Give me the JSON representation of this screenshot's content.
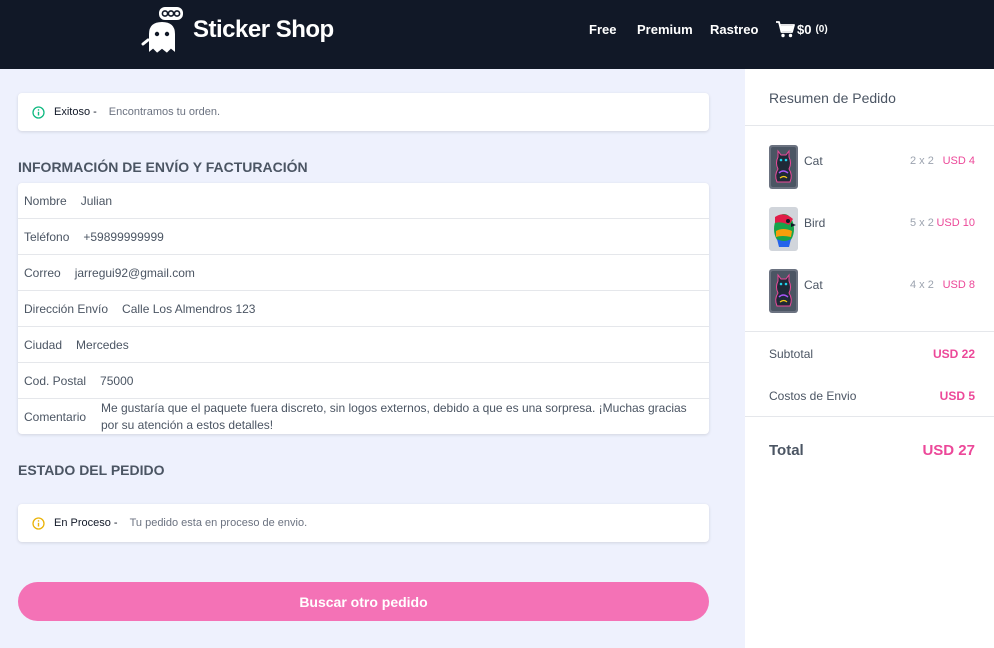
{
  "header": {
    "brand": "Sticker Shop",
    "logo_icon": "ghost-boo-icon",
    "nav": [
      "Free",
      "Premium",
      "Rastreo"
    ],
    "cart_icon": "cart-icon",
    "cart_total": "$0",
    "cart_count": "(0)"
  },
  "success_alert": {
    "icon": "info-circle-icon",
    "color": "#10b981",
    "label": "Exitoso -",
    "message": "Encontramos tu orden."
  },
  "shipping": {
    "title": "INFORMACIÓN DE ENVÍO Y FACTURACIÓN",
    "fields": [
      {
        "label": "Nombre",
        "value": "Julian"
      },
      {
        "label": "Teléfono",
        "value": "+59899999999"
      },
      {
        "label": "Correo",
        "value": "jarregui92@gmail.com"
      },
      {
        "label": "Dirección Envío",
        "value": "Calle Los Almendros 123"
      },
      {
        "label": "Ciudad",
        "value": "Mercedes"
      },
      {
        "label": "Cod. Postal",
        "value": "75000"
      },
      {
        "label": "Comentario",
        "value": "Me gustaría que el paquete fuera discreto, sin logos externos, debido a que es una sorpresa. ¡Muchas gracias por su atención a estos detalles!"
      }
    ]
  },
  "status": {
    "title": "ESTADO DEL PEDIDO",
    "icon": "info-circle-icon",
    "color": "#eab308",
    "label": "En Proceso -",
    "message": "Tu pedido esta en proceso de envio."
  },
  "search_button": "Buscar otro pedido",
  "summary": {
    "title": "Resumen de Pedido",
    "items": [
      {
        "name": "Cat",
        "size": "2 x 2",
        "price": "USD 4",
        "image": "cat-sticker"
      },
      {
        "name": "Bird",
        "size": "5 x 2",
        "price": "USD 10",
        "image": "bird-sticker"
      },
      {
        "name": "Cat",
        "size": "4 x 2",
        "price": "USD 8",
        "image": "cat-sticker"
      }
    ],
    "subtotal_label": "Subtotal",
    "subtotal_value": "USD 22",
    "shipping_label": "Costos de Envio",
    "shipping_value": "USD 5",
    "total_label": "Total",
    "total_value": "USD 27"
  },
  "colors": {
    "header_bg": "#111827",
    "accent": "#ec4899",
    "button": "#f472b6",
    "page_bg": "#eef1fd"
  }
}
